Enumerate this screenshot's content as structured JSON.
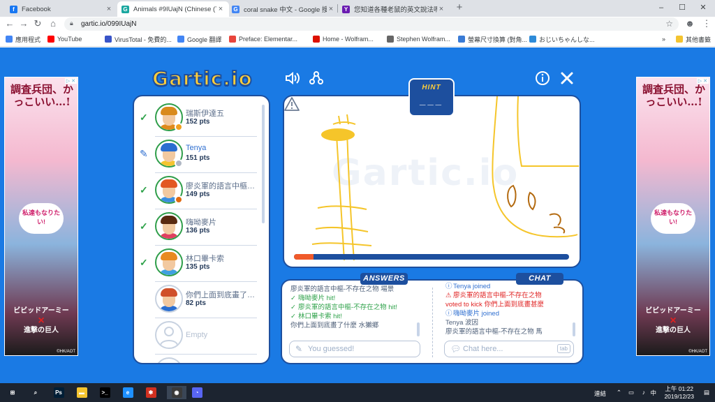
{
  "browser": {
    "tabs": [
      {
        "title": "Facebook",
        "favicon_color": "#1877f2",
        "favicon_glyph": "f",
        "active": false
      },
      {
        "title": "Animals #9IUajN (Chinese (Taiw",
        "favicon_color": "#1aa7a0",
        "favicon_glyph": "G",
        "active": true
      },
      {
        "title": "coral snake 中文 - Google 搜尋",
        "favicon_color": "#4285f4",
        "favicon_glyph": "G",
        "active": false
      },
      {
        "title": "您知道各種老鼠的英文說法嗎? |",
        "favicon_color": "#6a1bb1",
        "favicon_glyph": "Y",
        "active": false
      }
    ],
    "new_tab_label": "+",
    "url": "gartic.io/099IUajN",
    "bookmarks": [
      {
        "label": "應用程式",
        "color": "#4285f4"
      },
      {
        "label": "YouTube",
        "color": "#ff0000"
      },
      {
        "label": "VirusTotal - 免費的...",
        "color": "#3954c8"
      },
      {
        "label": "Google 翻譯",
        "color": "#4285f4"
      },
      {
        "label": "Preface: Elementar...",
        "color": "#e8453c"
      },
      {
        "label": "Home - Wolfram...",
        "color": "#dd1100"
      },
      {
        "label": "Stephen Wolfram...",
        "color": "#666666"
      },
      {
        "label": "螢幕尺寸換算 (對角...",
        "color": "#3a7bd5"
      },
      {
        "label": "おじいちゃんしな...",
        "color": "#2e8bd8"
      },
      {
        "label": "其他書籤",
        "color": "#f4c430"
      }
    ]
  },
  "game": {
    "logo": "Gartic.io",
    "hint_label": "HINT",
    "hint_value": "___",
    "watermark": "Gartic.io",
    "timer_fraction": 0.07,
    "colors": {
      "accent": "#1d4f9e",
      "background": "#1a7ae4",
      "yellow": "#ffce3a",
      "orange": "#f05a2a",
      "green": "#2fa24a"
    },
    "players": [
      {
        "name": "瑞斯伊達五",
        "points": "152 pts",
        "status": "check",
        "hair": "#d98a1c",
        "shirt": "#e08a1c",
        "dot": "#f0a020"
      },
      {
        "name": "Tenya",
        "points": "151 pts",
        "status": "pencil",
        "hair": "#2a6ed0",
        "shirt": "#f4c430",
        "dot": "#b0b8c4"
      },
      {
        "name": "廖炎軍的語言中樞-不存在之物",
        "points": "149 pts",
        "status": "check",
        "hair": "#e25822",
        "shirt": "#3a8ee0",
        "dot": "#e06a10"
      },
      {
        "name": "嗨呦麥片",
        "points": "136 pts",
        "status": "check",
        "hair": "#5a2a10",
        "shirt": "#e04060",
        "dot": null
      },
      {
        "name": "林口畢卡索",
        "points": "135 pts",
        "status": "check",
        "hair": "#e88a20",
        "shirt": "#40a0e0",
        "dot": null
      },
      {
        "name": "你們上面到底畫了什麼",
        "points": "82 pts",
        "status": "none",
        "hair": "#d0502a",
        "shirt": "#2a6ed0",
        "dot": null
      }
    ],
    "empty_slot_label": "Empty",
    "answers_label": "ANSWERS",
    "chat_label": "CHAT",
    "answers": [
      {
        "text": "廖炎軍的語言中樞-不存在之物 場景",
        "type": "normal"
      },
      {
        "text": "嗨呦麥片 hit!",
        "type": "hit"
      },
      {
        "text": "廖炎軍的語言中樞-不存在之物 hit!",
        "type": "hit"
      },
      {
        "text": "林口畢卡索 hit!",
        "type": "hit"
      },
      {
        "text": "你們上面到底畫了什麼 水獺鄉",
        "type": "normal"
      }
    ],
    "chat": [
      {
        "text": "Tenya joined",
        "type": "join",
        "icon": "ⓘ"
      },
      {
        "text": "廖炎軍的語言中樞-不存在之物",
        "type": "warn",
        "icon": "⚠"
      },
      {
        "text": "voted to kick 你們上面到底畫甚麼",
        "type": "warn",
        "icon": ""
      },
      {
        "text": "嗨呦麥片 joined",
        "type": "join",
        "icon": "ⓘ"
      },
      {
        "text": "Tenya 波因",
        "type": "normal",
        "icon": ""
      },
      {
        "text": "廖炎軍的語言中樞-不存在之物 馬",
        "type": "normal",
        "icon": ""
      }
    ],
    "answer_placeholder": "You guessed!",
    "chat_placeholder": "Chat here...",
    "tab_key_label": "tab"
  },
  "ads": {
    "title": "調査兵団、かっこいい…!",
    "bubble": "私達もなりたい!",
    "collab_top": "ビビッドアーミー",
    "collab_x": "×",
    "collab_bottom": "進撃の巨人",
    "copyright": "©HK/AOT",
    "ad_icons": "▷ ✕"
  },
  "taskbar": {
    "apps": [
      {
        "name": "windows-start",
        "glyph": "⊞",
        "color": ""
      },
      {
        "name": "search",
        "glyph": "⌕",
        "color": ""
      },
      {
        "name": "photoshop",
        "glyph": "Ps",
        "color": "#001e36"
      },
      {
        "name": "file-explorer",
        "glyph": "▬",
        "color": "#f4c430"
      },
      {
        "name": "terminal",
        "glyph": ">_",
        "color": "#000000"
      },
      {
        "name": "internet-explorer",
        "glyph": "e",
        "color": "#1e90ff"
      },
      {
        "name": "app-red",
        "glyph": "✱",
        "color": "#d03020"
      },
      {
        "name": "chrome",
        "glyph": "◉",
        "color": "#3a3a3a"
      },
      {
        "name": "discord",
        "glyph": "◔",
        "color": "#5865f2"
      }
    ],
    "tray_label": "連結",
    "time": "上午 01:22",
    "date": "2019/12/23"
  }
}
